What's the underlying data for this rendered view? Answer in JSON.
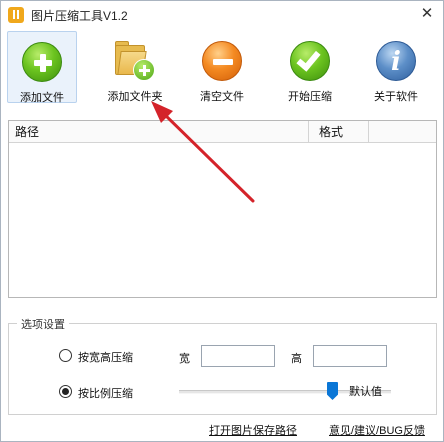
{
  "window": {
    "title": "图片压缩工具V1.2",
    "close_glyph": "✕"
  },
  "toolbar": {
    "add_file": "添加文件",
    "add_folder": "添加文件夹",
    "clear_files": "清空文件",
    "start_compress": "开始压缩",
    "about": "关于软件"
  },
  "file_list": {
    "columns": [
      "路径",
      "格式"
    ],
    "rows": []
  },
  "options": {
    "title": "选项设置",
    "by_size_label": "按宽高压缩",
    "width_label": "宽",
    "height_label": "高",
    "width_value": "",
    "height_value": "",
    "by_ratio_label": "按比例压缩",
    "by_ratio_selected": true,
    "slider_label": "默认值",
    "slider_level": 0.7
  },
  "footer": {
    "open_save_path": "打开图片保存路径",
    "feedback": "意见/建议/BUG反馈"
  },
  "colors": {
    "accent": "#0a76d6",
    "arrow": "#d4232a",
    "active_tool_bg": "#eaf2fb"
  },
  "icons": {
    "add_file": "green-plus-circle-icon",
    "add_folder": "folder-plus-icon",
    "clear": "orange-minus-circle-icon",
    "start": "green-check-circle-icon",
    "about": "blue-info-circle-icon"
  }
}
